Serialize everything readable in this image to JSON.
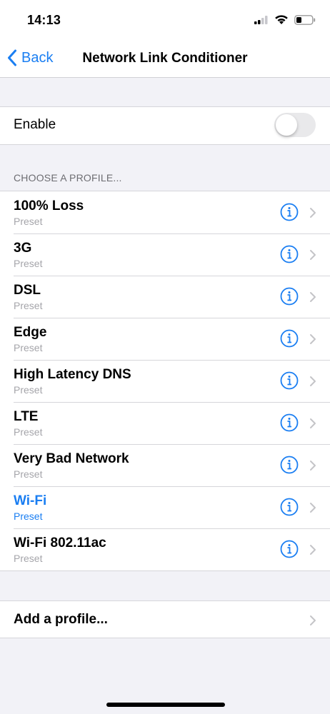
{
  "status_bar": {
    "time": "14:13"
  },
  "nav": {
    "back_label": "Back",
    "title": "Network Link Conditioner"
  },
  "enable": {
    "label": "Enable",
    "on": false
  },
  "section": {
    "header": "CHOOSE A PROFILE..."
  },
  "profiles": [
    {
      "name": "100% Loss",
      "type": "Preset",
      "selected": false
    },
    {
      "name": "3G",
      "type": "Preset",
      "selected": false
    },
    {
      "name": "DSL",
      "type": "Preset",
      "selected": false
    },
    {
      "name": "Edge",
      "type": "Preset",
      "selected": false
    },
    {
      "name": "High Latency DNS",
      "type": "Preset",
      "selected": false
    },
    {
      "name": "LTE",
      "type": "Preset",
      "selected": false
    },
    {
      "name": "Very Bad Network",
      "type": "Preset",
      "selected": false
    },
    {
      "name": "Wi-Fi",
      "type": "Preset",
      "selected": true
    },
    {
      "name": "Wi-Fi 802.11ac",
      "type": "Preset",
      "selected": false
    }
  ],
  "add_profile": {
    "label": "Add a profile..."
  },
  "colors": {
    "accent": "#1a7ef2",
    "background": "#f2f2f7",
    "secondary_text": "#a5a5aa"
  }
}
